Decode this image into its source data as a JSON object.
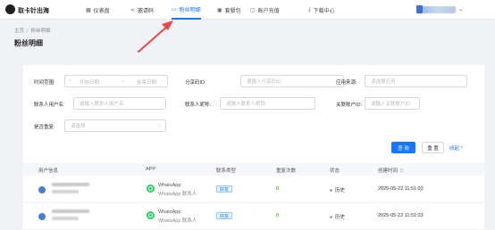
{
  "header": {
    "brand": "取卡针出海",
    "nav": [
      {
        "label": "仪表盘",
        "icon": "grid-icon",
        "glyph": "▦",
        "active": false
      },
      {
        "label": "邀请码",
        "icon": "share-icon",
        "glyph": "⋖",
        "active": false
      },
      {
        "label": "粉丝明细",
        "icon": "fans-icon",
        "glyph": "▭",
        "active": true
      },
      {
        "label": "套餐包",
        "icon": "package-icon",
        "glyph": "▣",
        "active": false
      },
      {
        "label": "账户充值",
        "icon": "wallet-icon",
        "glyph": "▢",
        "active": false
      },
      {
        "label": "下载中心",
        "icon": "download-icon",
        "glyph": "⤓",
        "active": false
      }
    ],
    "user_caret": "⌄"
  },
  "breadcrumb": {
    "home": "主页",
    "sep": "/",
    "current": "粉丝明细"
  },
  "page_title": "粉丝明细",
  "filters": {
    "time_label": "时间范围:",
    "date_start_placeholder": "开始日期",
    "date_sep": "→",
    "date_end_placeholder": "结束日期",
    "share_code_label": "分享码ID:",
    "share_code_placeholder": "请输入分享码ID",
    "app_source_label": "应用来源:",
    "app_source_placeholder": "请选择应用",
    "contact_user_label": "联系人用户名:",
    "contact_user_placeholder": "请输入联系人用户名",
    "contact_nick_label": "联系人昵称:",
    "contact_nick_placeholder": "请输入联系人昵称",
    "related_account_label": "关联账户ID:",
    "related_account_placeholder": "请输入关联账户ID",
    "repeat_label": "是否重复:",
    "repeat_placeholder": "请选择",
    "query_button": "查 询",
    "reset_button": "重 置",
    "collapse_link": "收起 ^"
  },
  "table": {
    "columns": [
      "用户信息",
      "APP",
      "联系类型",
      "重复次数",
      "状态",
      "创建时间"
    ],
    "sort_glyph": "⇅",
    "rows": [
      {
        "app_name": "WhatsApp",
        "app_sub": "WhatsApp 联系人",
        "type": "好友",
        "repeat": "0",
        "status": "历史",
        "created": "2025-05-22 11:51:03"
      },
      {
        "app_name": "WhatsApp",
        "app_sub": "WhatsApp 联系人",
        "type": "好友",
        "repeat": "0",
        "status": "历史",
        "created": "2025-05-22 11:51:03"
      }
    ]
  },
  "colors": {
    "accent": "#1677ff",
    "annotation_arrow": "#e8484a",
    "whatsapp": "#25d366"
  }
}
